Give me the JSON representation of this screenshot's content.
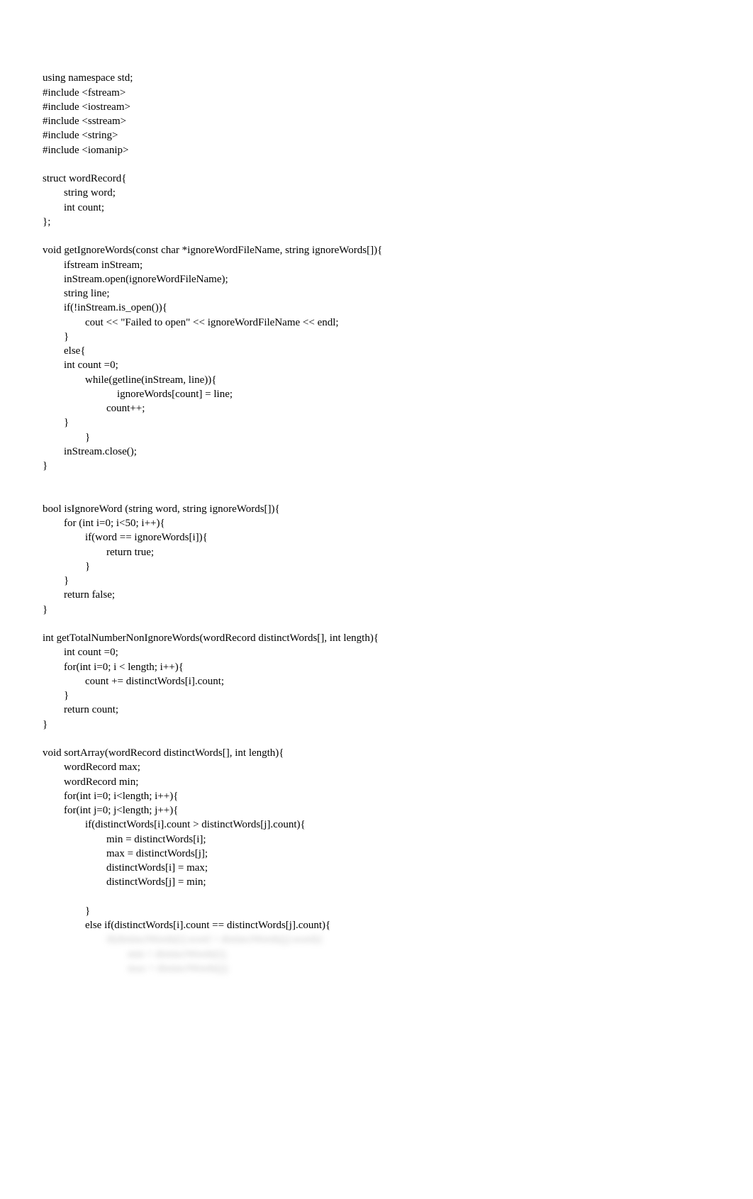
{
  "code": {
    "lines": [
      "using namespace std;",
      "#include <fstream>",
      "#include <iostream>",
      "#include <sstream>",
      "#include <string>",
      "#include <iomanip>",
      "",
      "struct wordRecord{",
      "        string word;",
      "        int count;",
      "};",
      "",
      "void getIgnoreWords(const char *ignoreWordFileName, string ignoreWords[]){",
      "        ifstream inStream;",
      "        inStream.open(ignoreWordFileName);",
      "        string line;",
      "        if(!inStream.is_open()){",
      "                cout << \"Failed to open\" << ignoreWordFileName << endl;",
      "        }",
      "        else{",
      "        int count =0;",
      "                while(getline(inStream, line)){",
      "                            ignoreWords[count] = line;",
      "                        count++;",
      "        }",
      "                }",
      "        inStream.close();",
      "}",
      "",
      "",
      "bool isIgnoreWord (string word, string ignoreWords[]){",
      "        for (int i=0; i<50; i++){",
      "                if(word == ignoreWords[i]){",
      "                        return true;",
      "                }",
      "        }",
      "        return false;",
      "}",
      "",
      "int getTotalNumberNonIgnoreWords(wordRecord distinctWords[], int length){",
      "        int count =0;",
      "        for(int i=0; i < length; i++){",
      "                count += distinctWords[i].count;",
      "        }",
      "        return count;",
      "}",
      "",
      "void sortArray(wordRecord distinctWords[], int length){",
      "        wordRecord max;",
      "        wordRecord min;",
      "        for(int i=0; i<length; i++){",
      "        for(int j=0; j<length; j++){",
      "                if(distinctWords[i].count > distinctWords[j].count){",
      "                        min = distinctWords[i];",
      "                        max = distinctWords[j];",
      "                        distinctWords[i] = max;",
      "                        distinctWords[j] = min;",
      "",
      "                }",
      "                else if(distinctWords[i].count == distinctWords[j].count){"
    ],
    "blurred_lines": [
      "                        if(distinctWords[i].word > distinctWords[j].word){",
      "                                min = distinctWords[i];",
      "                                max = distinctWords[j];"
    ]
  }
}
